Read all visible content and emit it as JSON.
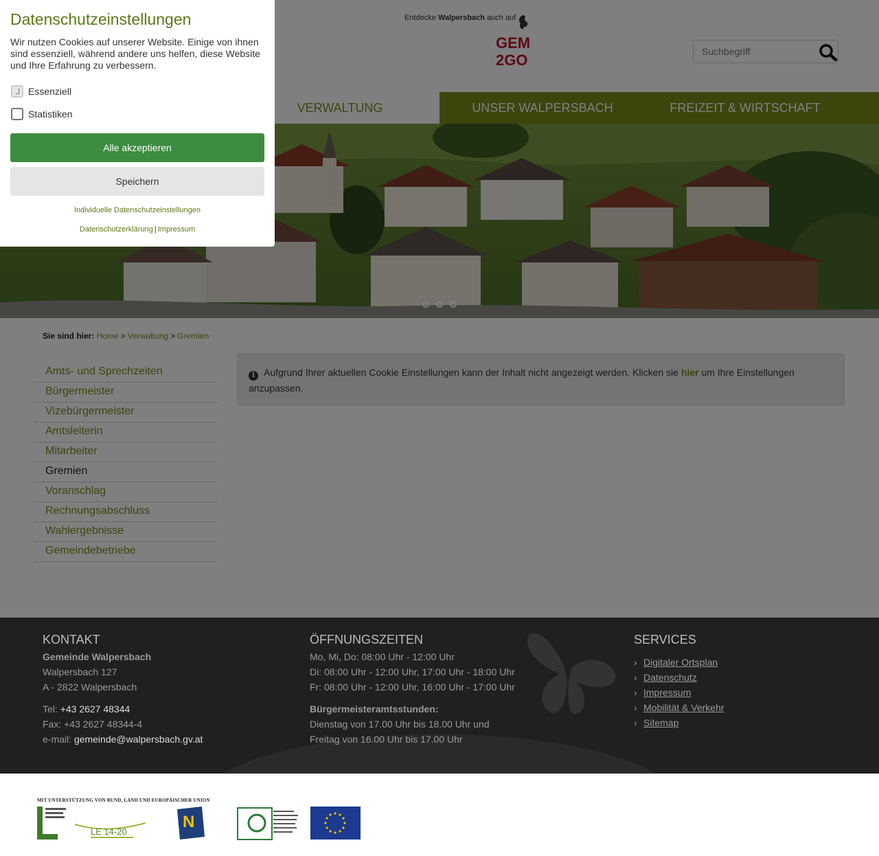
{
  "header": {
    "promo_prefix": "Entdecke",
    "promo_name": "Walpersbach",
    "promo_suffix": "auch auf",
    "gem_logo_line1": "GEM",
    "gem_logo_line2": "2GO",
    "search_placeholder": "Suchbegriff"
  },
  "nav": {
    "items": [
      {
        "label": "VERWALTUNG"
      },
      {
        "label": "UNSER WALPERSBACH"
      },
      {
        "label": "FREIZEIT & WIRTSCHAFT"
      }
    ]
  },
  "breadcrumb": {
    "prefix": "Sie sind hier:",
    "items": [
      "Home",
      "Verwaltung",
      "Gremien"
    ]
  },
  "sidebar": {
    "items": [
      {
        "label": "Amts- und Sprechzeiten"
      },
      {
        "label": "Bürgermeister"
      },
      {
        "label": "Vizebürgermeister"
      },
      {
        "label": "Amtsleiterin"
      },
      {
        "label": "Mitarbeiter"
      },
      {
        "label": "Gremien"
      },
      {
        "label": "Voranschlag"
      },
      {
        "label": "Rechnungsabschluss"
      },
      {
        "label": "Wahlergebnisse"
      },
      {
        "label": "Gemeindebetriebe"
      }
    ]
  },
  "notice": {
    "text_before": "Aufgrund Ihrer aktuellen Cookie Einstellungen kann der Inhalt nicht angezeigt werden. Klicken sie",
    "link": "hier",
    "text_after": "um Ihre Einstellungen anzupassen."
  },
  "footer": {
    "contact": {
      "heading": "KONTAKT",
      "name": "Gemeinde Walpersbach",
      "street": "Walpersbach 127",
      "city": "A - 2822 Walpersbach",
      "tel_label": "Tel:",
      "tel": "+43 2627 48344",
      "fax": "Fax: +43 2627 48344-4",
      "email_label": "e-mail:",
      "email": "gemeinde@walpersbach.gv.at"
    },
    "hours": {
      "heading": "ÖFFNUNGSZEITEN",
      "line1": "Mo, Mi, Do: 08:00 Uhr - 12:00 Uhr",
      "line2": "Di: 08:00 Uhr - 12:00 Uhr, 17:00 Uhr - 18:00 Uhr",
      "line3": "Fr: 08:00 Uhr - 12:00 Uhr, 16:00 Uhr - 17:00 Uhr",
      "mayor_heading": "Bürgermeisteramtsstunden:",
      "mayor_line1": "Dienstag von 17.00 Uhr bis 18.00 Uhr und",
      "mayor_line2": "Freitag von 16.00 Uhr bis 17.00 Uhr"
    },
    "services": {
      "heading": "SERVICES",
      "items": [
        "Digitaler Ortsplan",
        "Datenschutz",
        "Impressum",
        "Mobilität & Verkehr",
        "Sitemap"
      ]
    }
  },
  "sponsors": {
    "caption": "MIT UNTERSTÜTZUNG VON BUND, LAND UND EUROPÄISCHER UNION",
    "le_label": "LE 14-20"
  },
  "cookie_dialog": {
    "title": "Datenschutzeinstellungen",
    "intro": "Wir nutzen Cookies auf unserer Website. Einige von ihnen sind essenziell, während andere uns helfen, diese Website und Ihre Erfahrung zu verbessern.",
    "option_essential": "Essenziell",
    "option_statistics": "Statistiken",
    "accept_all": "Alle akzeptieren",
    "save": "Speichern",
    "individual": "Individuelle Datenschutzeinstellungen",
    "privacy": "Datenschutzerklärung",
    "imprint": "Impressum"
  },
  "colors": {
    "brand_green": "#7a8a1a",
    "accept_green": "#3d8c3f",
    "footer_bg": "#202020",
    "gem_red": "#b8152a"
  }
}
